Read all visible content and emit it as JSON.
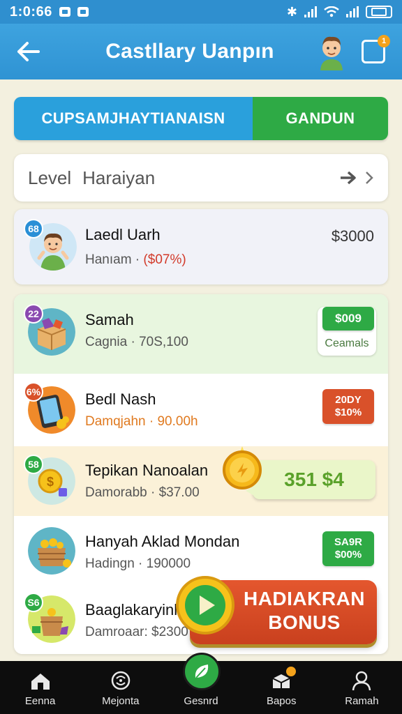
{
  "status_bar": {
    "time": "1:0:66"
  },
  "app_bar": {
    "title": "Castllary Uanpın"
  },
  "tabs": [
    {
      "label": "CUPSAMJHAYTIANAISN"
    },
    {
      "label": "GANDUN"
    }
  ],
  "level_row": {
    "label": "Level",
    "value": "Haraiyan"
  },
  "items": [
    {
      "rank": "68",
      "title": "Laedl Uarh",
      "sub": "Hanıam ·",
      "sub_pct": "($07%)",
      "price": "$3000"
    },
    {
      "rank": "22",
      "title": "Samah",
      "sub": "Cagnia · 7​0S,100",
      "price": "$009",
      "badge_sub": "Ceamals"
    },
    {
      "rank": "6%",
      "title": "Bedl Nash",
      "sub": "Damqjahn · 90.00h",
      "price_line1": "20DY",
      "price_line2": "$10%"
    },
    {
      "rank": "58",
      "title": "Tepikan Nanoalan",
      "sub": "Damorabb · $37.00",
      "reward": "351 $4"
    },
    {
      "rank": "",
      "title": "Hanyah Aklad Mondan",
      "sub": "Hadingn · 190000",
      "price_line1": "SA9R",
      "price_line2": "$00%"
    },
    {
      "rank": "S6",
      "title": "Baaglakaryinl",
      "sub": "Damroaar: $2300"
    }
  ],
  "bonus_button": {
    "line1": "HADIAKRAN",
    "line2": "BONUS"
  },
  "bottom_nav": [
    {
      "label": "Eenna",
      "icon": "home-icon"
    },
    {
      "label": "Mejonta",
      "icon": "globe-icon"
    },
    {
      "label": "Gesnrd",
      "icon": "leaf-icon"
    },
    {
      "label": "Bapos",
      "icon": "box-icon"
    },
    {
      "label": "Ramah",
      "icon": "user-icon"
    }
  ],
  "colors": {
    "app_bar": "#3ea3df",
    "tab_blue": "#2aa0dc",
    "tab_green": "#2eaa45",
    "bonus_red": "#d9512a",
    "nav_bg": "#0d0d0d"
  }
}
